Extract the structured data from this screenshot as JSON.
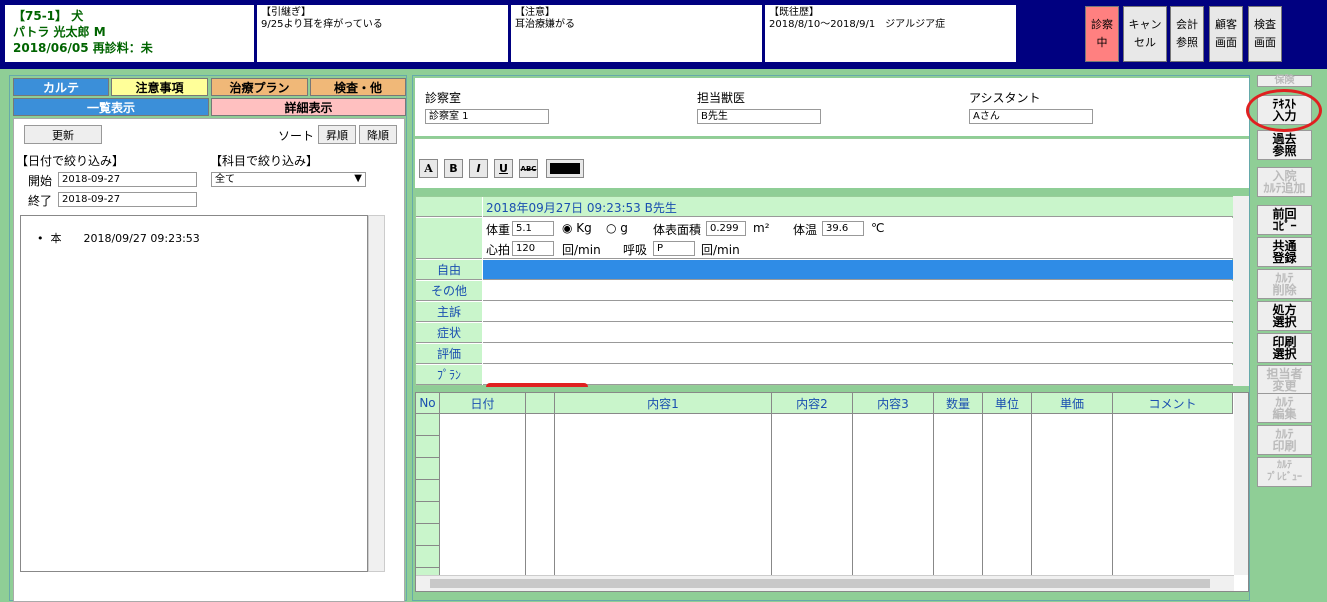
{
  "header": {
    "patient_line1": "【75-1】 犬",
    "patient_line2": "パトラ 光太郎 M",
    "patient_line3": "2018/06/05 再診料：未",
    "hikitsugi_label": "【引継ぎ】",
    "hikitsugi_text": "9/25より耳を痒がっている",
    "chui_label": "【注意】",
    "chui_text": "耳治療嫌がる",
    "kiou_label": "【既往歴】",
    "kiou_text": "2018/8/10～2018/9/1　ジアルジア症",
    "buttons": {
      "shinsatsu_1": "診察",
      "shinsatsu_2": "中",
      "cancel_1": "キャン",
      "cancel_2": "セル",
      "kaikei_1": "会計",
      "kaikei_2": "参照",
      "kokyaku_1": "顧客",
      "kokyaku_2": "画面",
      "kensa_1": "検査",
      "kensa_2": "画面"
    }
  },
  "left": {
    "tabs": {
      "karte": "カルテ",
      "chui": "注意事項",
      "chiryo": "治療プラン",
      "kensa": "検査・他",
      "ichiran": "一覧表示",
      "shosai": "詳細表示"
    },
    "update_button": "更新",
    "sort_label": "ソート",
    "asc": "昇順",
    "desc": "降順",
    "date_filter": "【日付で絞り込み】",
    "subject_filter": "【科目で絞り込み】",
    "start_label": "開始",
    "start_value": "2018-09-27",
    "end_label": "終了",
    "end_value": "2018-09-27",
    "subject_value": "全て",
    "history_item": "本　　2018/09/27 09:23:53"
  },
  "main": {
    "room_label": "診察室",
    "room_value": "診察室 1",
    "vet_label": "担当獣医",
    "vet_value": "B先生",
    "assistant_label": "アシスタント",
    "assistant_value": "Aさん",
    "toolbar": {
      "font": "A",
      "bold": "B",
      "italic": "I",
      "underline": "U",
      "strike": "ABC"
    },
    "record": {
      "date_line": "2018年09月27日 09:23:53 B先生",
      "weight_label": "体重",
      "weight_value": "5.1",
      "kg": "Kg",
      "g": "g",
      "bsa_label": "体表面積",
      "bsa_value": "0.299",
      "bsa_unit": "m²",
      "temp_label": "体温",
      "temp_value": "39.6",
      "temp_unit": "℃",
      "hr_label": "心拍",
      "hr_value": "120",
      "hr_unit": "回/min",
      "resp_label": "呼吸",
      "resp_value": "P",
      "resp_unit": "回/min",
      "rows": [
        "自由",
        "その他",
        "主訴",
        "症状",
        "評価",
        "ﾌﾟﾗﾝ"
      ]
    },
    "grid_headers": [
      "No",
      "日付",
      "",
      "内容1",
      "内容2",
      "内容3",
      "数量",
      "単位",
      "単価",
      "コメント"
    ]
  },
  "side": {
    "hoken": "保険",
    "text_input_1": "ﾃｷｽﾄ",
    "text_input_2": "入力",
    "kako_1": "過去",
    "kako_2": "参照",
    "nyuin_1": "入院",
    "nyuin_2": "ｶﾙﾃ追加",
    "zenkai_1": "前回",
    "zenkai_2": "ｺﾋﾟｰ",
    "kyotsu_1": "共通",
    "kyotsu_2": "登録",
    "delete_1": "ｶﾙﾃ",
    "delete_2": "削除",
    "shohou_1": "処方",
    "shohou_2": "選択",
    "print_1": "印刷",
    "print_2": "選択",
    "tanto_1": "担当者",
    "tanto_2": "変更",
    "edit_1": "ｶﾙﾃ",
    "edit_2": "編集",
    "print2_1": "ｶﾙﾃ",
    "print2_2": "印刷",
    "preview_1": "ｶﾙﾃ",
    "preview_2": "ﾌﾟﾚﾋﾞｭｰ"
  }
}
